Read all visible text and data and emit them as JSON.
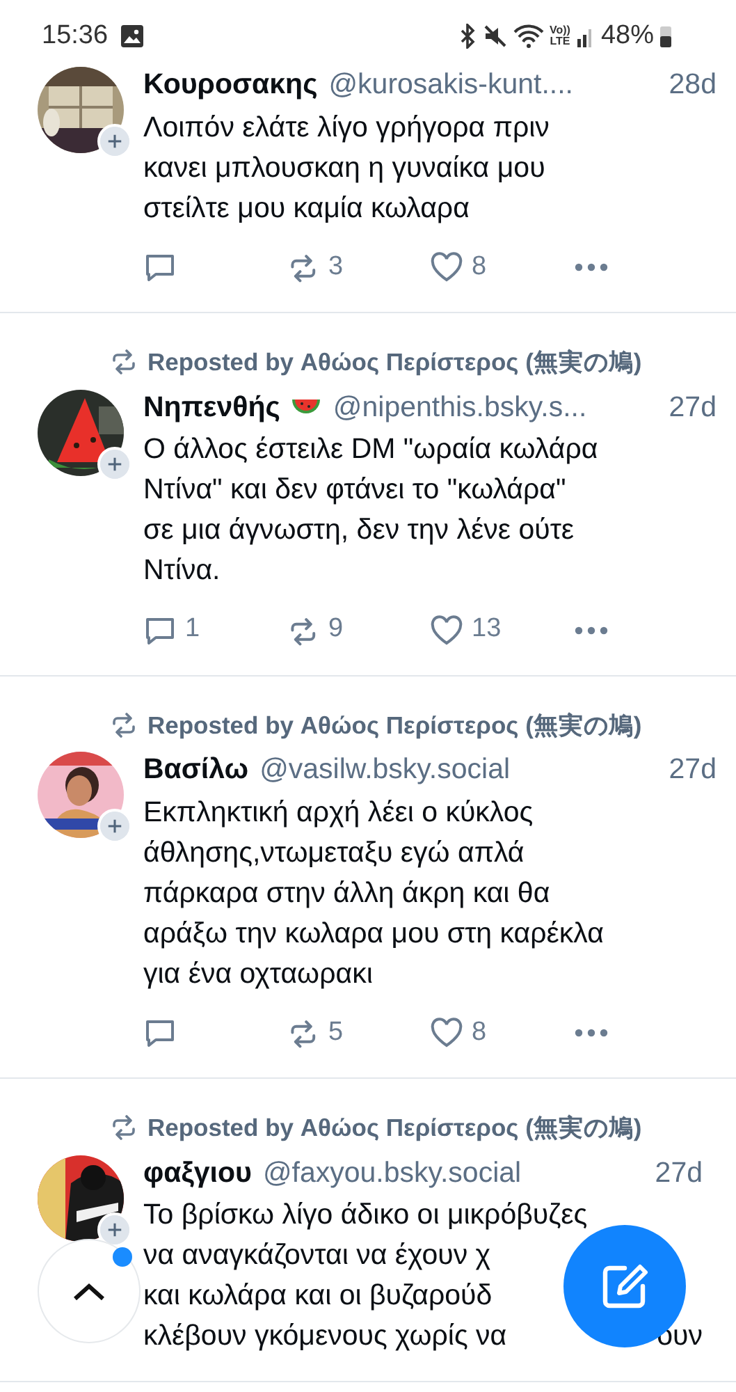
{
  "status_bar": {
    "time": "15:36",
    "volte_top": "Vo))",
    "volte_bottom": "LTE",
    "battery_text": "48%"
  },
  "posts": [
    {
      "author": "Κουροσακης",
      "handle": "@kurosakis-kunt....",
      "time": "28d",
      "text": "Λοιπόν ελάτε λίγο γρήγορα πριν\nκανει μπλουσκαη η γυναίκα μου\nστείλτε μου καμία κωλαρα",
      "actions": {
        "repost_count": "3",
        "like_count": "8"
      }
    },
    {
      "reposted_by": "Reposted by Αθώος Περίστερος (無実の鳩)",
      "author": "Νηπενθής",
      "name_icon": true,
      "handle": "@nipenthis.bsky.s...",
      "time": "27d",
      "text": "Ο άλλος έστειλε DM \"ωραία κωλάρα\nΝτίνα\" και δεν φτάνει το \"κωλάρα\"\nσε μια άγνωστη, δεν την λένε ούτε\nΝτίνα.",
      "actions": {
        "reply_count": "1",
        "repost_count": "9",
        "like_count": "13"
      }
    },
    {
      "reposted_by": "Reposted by Αθώος Περίστερος (無実の鳩)",
      "author": "Βασίλω",
      "handle": "@vasilw.bsky.social",
      "time": "27d",
      "text": "Εκπληκτική αρχή λέει ο κύκλος\nάθλησης,ντωμεταξυ εγώ απλά\nπάρκαρα στην άλλη άκρη και θα\nαράξω την κωλαρα μου στη καρέκλα\nγια ένα οχταωρακι",
      "actions": {
        "repost_count": "5",
        "like_count": "8"
      }
    },
    {
      "reposted_by": "Reposted by Αθώος Περίστερος (無実の鳩)",
      "author": "φαξγιου",
      "handle": "@faxyou.bsky.social",
      "time": "27d",
      "text": "Το βρίσκω λίγο άδικο οι μικρόβυζες\nνα αναγκάζονται να έχουν χ\nκαι κωλάρα και οι βυζαρούδ\nκλέβουν γκόμενους χωρίς να",
      "text_tail": "ουν"
    }
  ],
  "scroll_top": {
    "has_new": true
  }
}
